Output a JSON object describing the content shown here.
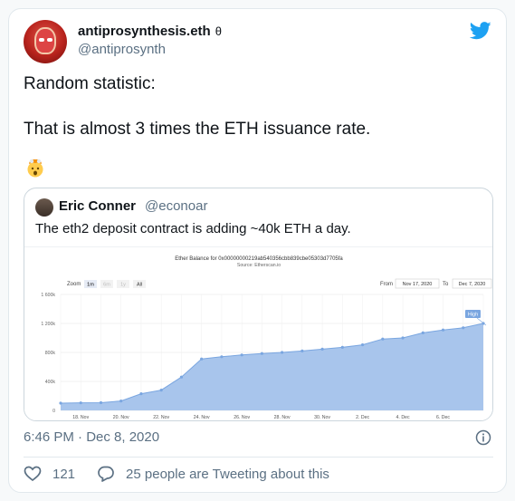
{
  "author": {
    "display_name": "antiprosynthesis.eth",
    "name_glyph": "θ",
    "handle": "@antiprosynth"
  },
  "tweet": {
    "lines": [
      "Random statistic:",
      "That is almost 3 times the ETH issuance rate."
    ],
    "emoji": "exploding-head"
  },
  "quoted": {
    "display_name": "Eric Conner",
    "handle": "@econoar",
    "text": "The eth2 deposit contract is adding ~40k ETH a day."
  },
  "chart_data": {
    "type": "area",
    "title": "Ether Balance for 0x00000000219ab540356cbb839cbe05303d7705fa",
    "subtitle": "Source: Etherscan.io",
    "zoom_label": "Zoom",
    "zoom_options": [
      "1m",
      "6m",
      "1y",
      "All"
    ],
    "from_label": "From",
    "from_value": "Nov 17, 2020",
    "to_label": "To",
    "to_value": "Dec 7, 2020",
    "high_label": "High",
    "x": [
      "17. Nov",
      "18. Nov",
      "19. Nov",
      "20. Nov",
      "21. Nov",
      "22. Nov",
      "23. Nov",
      "24. Nov",
      "25. Nov",
      "26. Nov",
      "27. Nov",
      "28. Nov",
      "29. Nov",
      "30. Nov",
      "1. Dec",
      "2. Dec",
      "3. Dec",
      "4. Dec",
      "5. Dec",
      "6. Dec",
      "7. Dec"
    ],
    "values": [
      100000,
      104000,
      106000,
      130000,
      230000,
      280000,
      460000,
      710000,
      740000,
      765000,
      785000,
      800000,
      820000,
      845000,
      870000,
      905000,
      985000,
      1000000,
      1070000,
      1110000,
      1140000,
      1200000
    ],
    "x_ticks": [
      "18. Nov",
      "20. Nov",
      "22. Nov",
      "24. Nov",
      "26. Nov",
      "28. Nov",
      "30. Nov",
      "2. Dec",
      "4. Dec",
      "6. Dec"
    ],
    "y_ticks": [
      "0",
      "400k",
      "800k",
      "1 200k",
      "1 600k"
    ],
    "ylim": [
      0,
      1600000
    ],
    "grid": true,
    "fill_color": "#a8c5ec",
    "line_color": "#7aa6e0"
  },
  "footer": {
    "timestamp": "6:46 PM · Dec 8, 2020",
    "likes": "121",
    "tweeting": "25 people are Tweeting about this"
  },
  "colors": {
    "twitter_blue": "#1da1f2",
    "secondary_text": "#5b7083"
  }
}
